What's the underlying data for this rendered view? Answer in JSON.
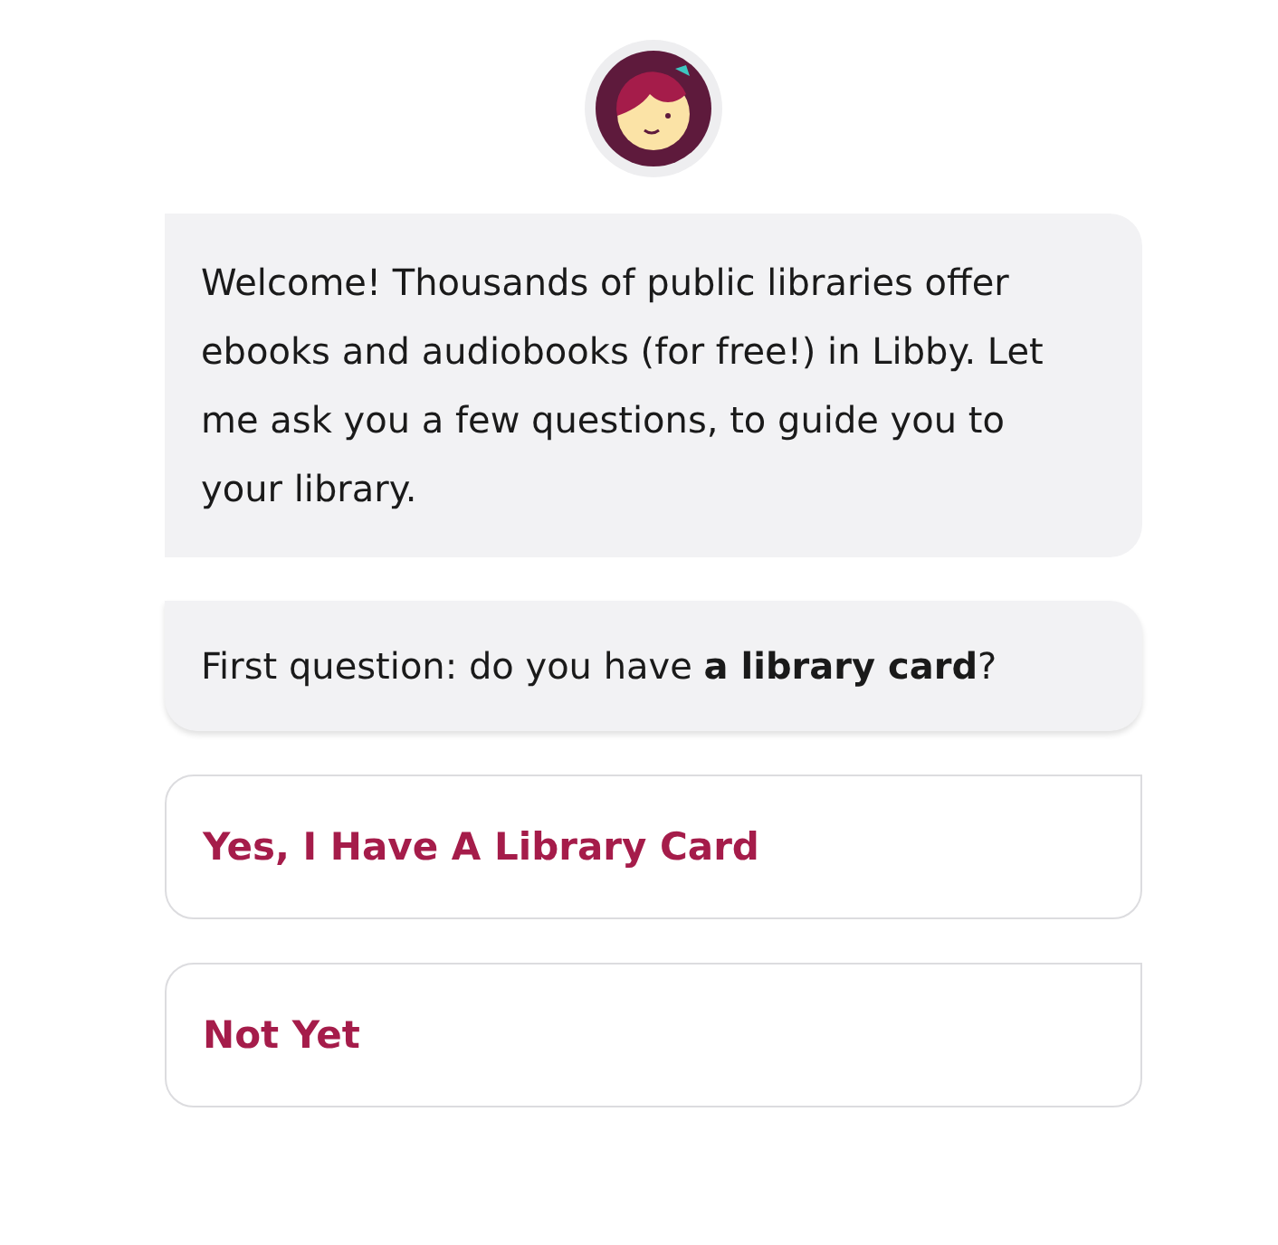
{
  "messages": [
    {
      "text": "Welcome! Thousands of public libraries offer ebooks and audiobooks (for free!) in Libby. Let me ask you a few questions, to guide you to your library.",
      "raised": false
    },
    {
      "text": "First question: do you have **a library card**?",
      "raised": true
    }
  ],
  "answers": [
    "Yes, I Have A Library Card",
    "Not Yet"
  ]
}
